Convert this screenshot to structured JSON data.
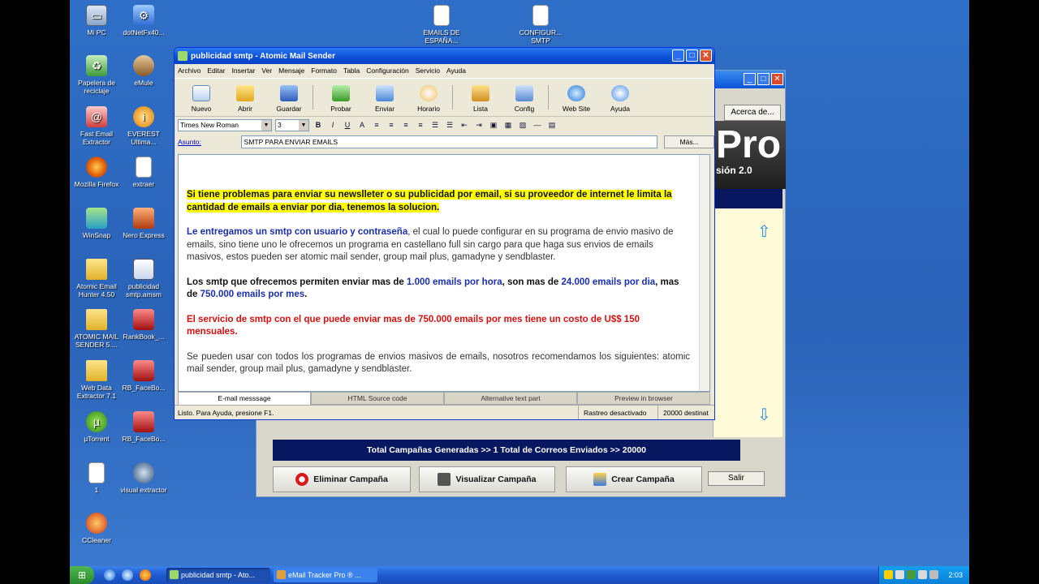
{
  "desktop_icons": [
    {
      "label": "Mi PC",
      "icon": "computer-icon"
    },
    {
      "label": "dotNetFx40...",
      "icon": "setup-icon"
    },
    {
      "label": "Papelera de reciclaje",
      "icon": "recycle-bin-icon"
    },
    {
      "label": "eMule",
      "icon": "emule-icon"
    },
    {
      "label": "Fast Email Extractor",
      "icon": "fast-email-extractor-icon"
    },
    {
      "label": "EVEREST Ultima...",
      "icon": "everest-icon"
    },
    {
      "label": "Mozilla Firefox",
      "icon": "firefox-icon"
    },
    {
      "label": "extraer",
      "icon": "text-file-icon"
    },
    {
      "label": "WinSnap",
      "icon": "winsnap-icon"
    },
    {
      "label": "Nero Express",
      "icon": "nero-icon"
    },
    {
      "label": "Atomic Email Hunter 4.50",
      "icon": "folder-icon"
    },
    {
      "label": "publicidad smtp.amsm",
      "icon": "document-icon"
    },
    {
      "label": "ATOMIC MAIL SENDER 5....",
      "icon": "folder-icon"
    },
    {
      "label": "RankBook_...",
      "icon": "rankbook-icon"
    },
    {
      "label": "Web Data Extractor 7.1",
      "icon": "folder-icon"
    },
    {
      "label": "RB_FaceBo...",
      "icon": "rankbook-icon"
    },
    {
      "label": "µTorrent",
      "icon": "utorrent-icon"
    },
    {
      "label": "RB_FaceBo...",
      "icon": "rankbook-icon"
    },
    {
      "label": "1",
      "icon": "text-file-icon"
    },
    {
      "label": "visual extractor",
      "icon": "magnifier-icon"
    },
    {
      "label": "CCleaner",
      "icon": "ccleaner-icon"
    },
    {
      "label": "EMAILS DE ESPAÑA...",
      "icon": "text-file-icon"
    },
    {
      "label": "CONFIGUR... SMTP",
      "icon": "text-file-icon"
    }
  ],
  "back_window": {
    "acerca": "Acerca de...",
    "logo_big": "Pro",
    "logo_version": "sión 2.0",
    "totals": "Total Campañas Generadas >> 1    Total de Correos Enviados >> 20000",
    "buttons": {
      "eliminar": "Eliminar Campaña",
      "visualizar": "Visualizar Campaña",
      "crear": "Crear Campaña",
      "salir": "Salir"
    }
  },
  "window": {
    "title": "publicidad smtp - Atomic Mail Sender",
    "menu": [
      "Archivo",
      "Editar",
      "Insertar",
      "Ver",
      "Mensaje",
      "Formato",
      "Tabla",
      "Configuración",
      "Servicio",
      "Ayuda"
    ],
    "toolbar": [
      "Nuevo",
      "Abrir",
      "Guardar",
      "Probar",
      "Enviar",
      "Horario",
      "Lista",
      "Config",
      "Web Site",
      "Ayuda"
    ],
    "font_name": "Times New Roman",
    "font_size": "3",
    "subject_label": "Asunto:",
    "subject_value": "SMTP PARA ENVIAR EMAILS",
    "more_button": "Más...",
    "body": {
      "p1": "Si tiene problemas para enviar su newslleter o su publicidad por email, si su proveedor de internet le limita la cantidad de emails a enviar por dia, tenemos la solucion.",
      "p2_bold": "Le entregamos un smtp con usuario y contraseña",
      "p2_rest": ", el cual lo puede configurar en su programa de envio masivo de emails, sino tiene uno le ofrecemos un programa en castellano full sin cargo para que haga sus envios de emails masivos, estos pueden ser atomic mail sender, group mail plus, gamadyne y sendblaster.",
      "p3_a": "Los smtp que ofrecemos permiten enviar mas de ",
      "p3_b": "1.000 emails por hora",
      "p3_c": ", son mas de ",
      "p3_d": "24.000 emails por dia",
      "p3_e": ", mas de ",
      "p3_f": "750.000 emails por mes",
      "p3_g": ".",
      "p4": "El servicio de smtp con el que puede enviar mas de 750.000 emails por mes tiene un costo de U$$ 150 mensuales.",
      "p5": "Se pueden usar con todos los programas de envios masivos de emails, nosotros recomendamos los siguientes:                          atomic mail sender, group mail plus, gamadyne y sendblaster."
    },
    "tabs": [
      "E-mail messsage",
      "HTML Source code",
      "Alternative text part",
      "Preview in browser"
    ],
    "status": {
      "left": "Listo. Para Ayuda, presione F1.",
      "middle": "Rastreo desactivado",
      "right": "20000 destinat"
    }
  },
  "taskbar": {
    "tasks": [
      "publicidad smtp - Ato...",
      "eMail Tracker Pro ®  ..."
    ],
    "clock": "2:03"
  }
}
